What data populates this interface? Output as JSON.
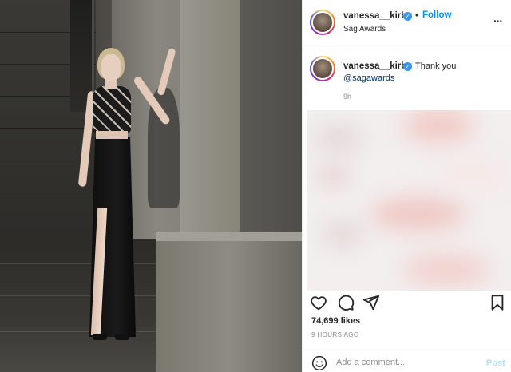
{
  "header": {
    "username": "vanessa__kirby",
    "separator": "•",
    "follow_label": "Follow",
    "location": "Sag Awards",
    "more_label": "···"
  },
  "caption": {
    "username": "vanessa__kirby",
    "text": "Thank you",
    "mention": "@sagawards",
    "time": "9h"
  },
  "stats": {
    "likes": "74,699 likes",
    "time_ago": "9 HOURS AGO"
  },
  "comment": {
    "placeholder": "Add a comment...",
    "post_label": "Post"
  },
  "colors": {
    "accent": "#0095f6",
    "verified": "#3897f0",
    "post_disabled": "#b2dffc"
  },
  "icons": {
    "verified": "verified-badge-icon",
    "like": "heart-icon",
    "comment": "comment-icon",
    "share": "paper-plane-icon",
    "save": "bookmark-icon",
    "emoji": "smiley-icon",
    "more": "more-options-icon"
  }
}
